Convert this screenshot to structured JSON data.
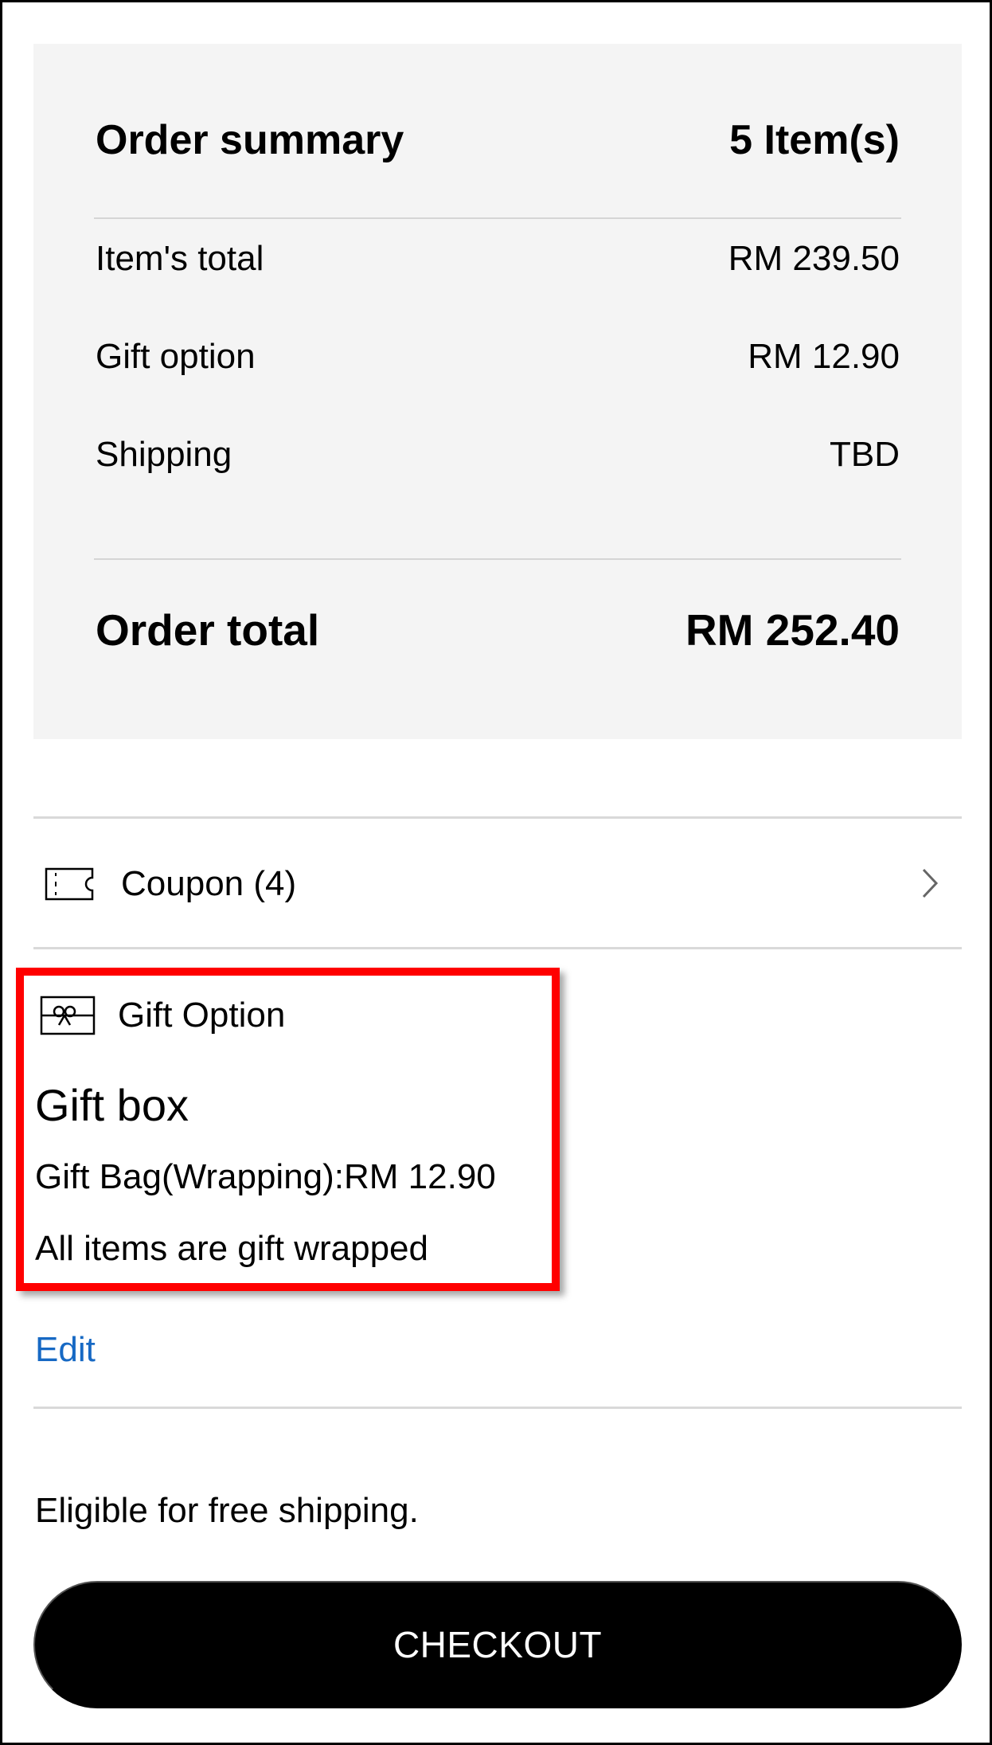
{
  "summary": {
    "title": "Order summary",
    "item_count": "5 Item(s)",
    "rows": [
      {
        "label": "Item's total",
        "value": "RM 239.50"
      },
      {
        "label": "Gift option",
        "value": "RM 12.90"
      },
      {
        "label": "Shipping",
        "value": "TBD"
      }
    ],
    "total_label": "Order total",
    "total_value": "RM 252.40"
  },
  "coupon": {
    "label": "Coupon (4)",
    "icon": "ticket-icon",
    "chevron_icon": "chevron-right-icon"
  },
  "gift": {
    "heading": "Gift Option",
    "icon": "gift-card-icon",
    "type": "Gift box",
    "detail": "Gift Bag(Wrapping):RM 12.90",
    "note": "All items are gift wrapped",
    "edit_label": "Edit"
  },
  "shipping_note": "Eligible for free shipping.",
  "checkout_label": "CHECKOUT",
  "colors": {
    "summary_bg": "#f4f4f4",
    "highlight": "#ff0000",
    "link": "#1769c4",
    "button": "#000000"
  }
}
